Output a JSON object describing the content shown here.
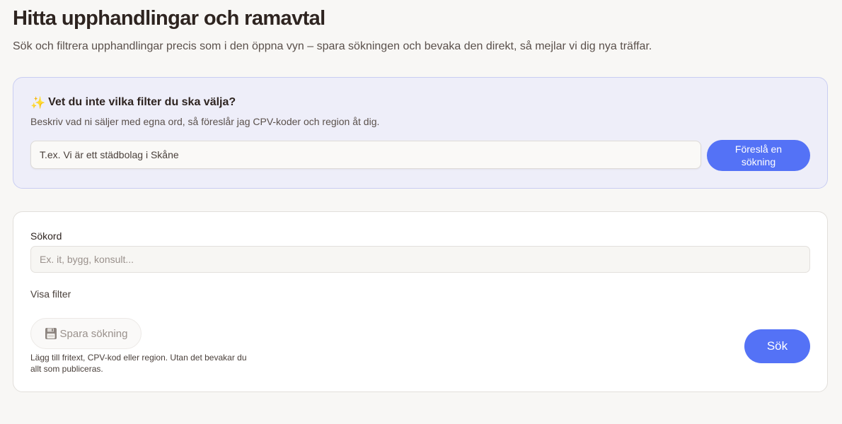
{
  "header": {
    "title": "Hitta upphandlingar och ramavtal",
    "subtitle": "Sök och filtrera upphandlingar precis som i den öppna vyn – spara sökningen och bevaka den direkt, så mejlar vi dig nya träffar."
  },
  "ai_suggest": {
    "icon": "sparkles-icon",
    "heading": "Vet du inte vilka filter du ska välja?",
    "description": "Beskriv vad ni säljer med egna ord, så föreslår jag CPV-koder och region åt dig.",
    "input_value": "",
    "input_placeholder": "T.ex. Vi är ett städbolag i Skåne",
    "button_label": "Föreslå en sökning"
  },
  "search": {
    "keyword_label": "Sökord",
    "keyword_value": "",
    "keyword_placeholder": "Ex. it, bygg, konsult...",
    "show_filters_label": "Visa filter",
    "save_button_label": "Spara sökning",
    "save_icon": "floppy-disk-icon",
    "save_hint": "Lägg till fritext, CPV-kod eller region. Utan det bevakar du allt som publiceras.",
    "search_button_label": "Sök"
  },
  "colors": {
    "accent": "#5472f6",
    "ai_card_background": "#eeeef9",
    "ai_card_border": "#c9cdf2",
    "page_background": "#f8f7f5"
  }
}
